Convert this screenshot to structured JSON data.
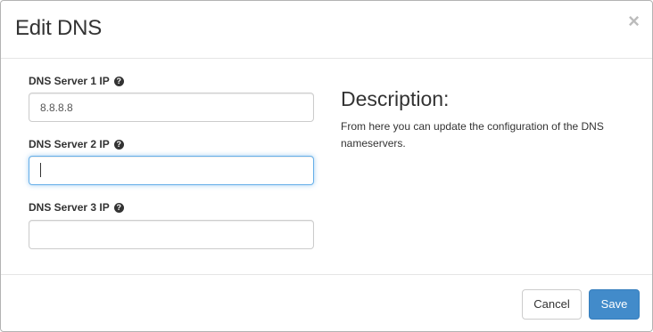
{
  "dialog": {
    "title": "Edit DNS",
    "close_glyph": "×"
  },
  "fields": [
    {
      "label": "DNS Server 1 IP",
      "value": "8.8.8.8",
      "help_glyph": "?"
    },
    {
      "label": "DNS Server 2 IP",
      "value": "",
      "help_glyph": "?"
    },
    {
      "label": "DNS Server 3 IP",
      "value": "",
      "help_glyph": "?"
    }
  ],
  "description": {
    "heading": "Description:",
    "text": "From here you can update the configuration of the DNS nameservers."
  },
  "footer": {
    "cancel_label": "Cancel",
    "save_label": "Save"
  },
  "colors": {
    "primary": "#428bca",
    "focus_border": "#66afe9"
  },
  "icons": {
    "close": "close-icon",
    "help": "question-circle-icon"
  }
}
